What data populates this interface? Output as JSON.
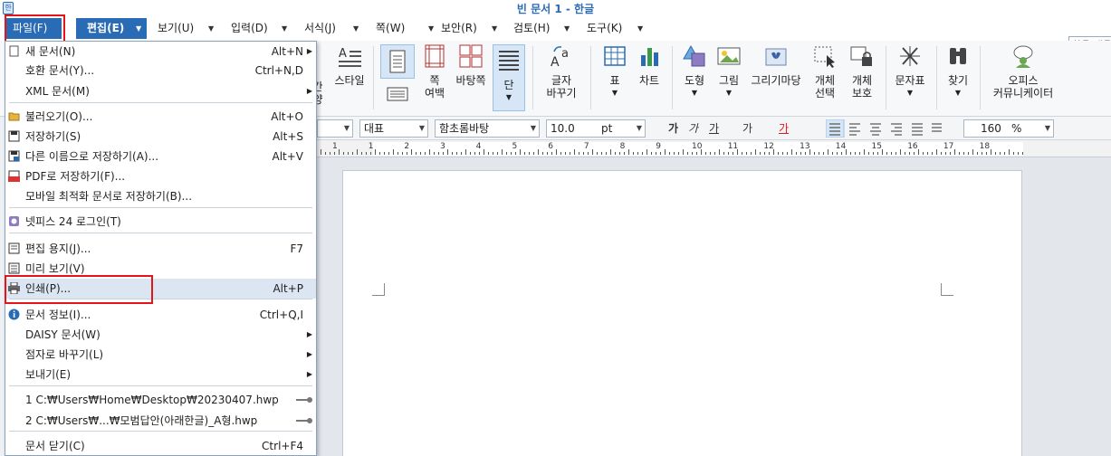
{
  "window": {
    "title": "빈 문서 1 - 한글",
    "app_icon": "hwp-app-icon"
  },
  "menubar": {
    "items": [
      {
        "label": "파일(F)"
      },
      {
        "label": "편집(E)"
      },
      {
        "label": "보기(U)"
      },
      {
        "label": "입력(D)"
      },
      {
        "label": "서식(J)"
      },
      {
        "label": "쪽(W)"
      },
      {
        "label": "보안(R)"
      },
      {
        "label": "검토(H)"
      },
      {
        "label": "도구(K)"
      }
    ],
    "search_placeholder": "찾을 내용"
  },
  "ribbon": {
    "partial_labels": [
      "간",
      "양",
      "스타일"
    ],
    "buttons": [
      {
        "label": "쪽\n여백",
        "icon": "page-margin-icon"
      },
      {
        "label": "바탕쪽",
        "icon": "master-page-icon"
      },
      {
        "label": "단",
        "icon": "columns-icon"
      },
      {
        "label": "글자\n바꾸기",
        "icon": "char-replace-icon"
      },
      {
        "label": "표",
        "icon": "table-icon"
      },
      {
        "label": "차트",
        "icon": "chart-icon"
      },
      {
        "label": "도형",
        "icon": "shape-icon"
      },
      {
        "label": "그림",
        "icon": "picture-icon"
      },
      {
        "label": "그리기마당",
        "icon": "clipart-icon"
      },
      {
        "label": "개체\n선택",
        "icon": "object-select-icon"
      },
      {
        "label": "개체\n보호",
        "icon": "object-protect-icon"
      },
      {
        "label": "문자표",
        "icon": "symbol-icon"
      },
      {
        "label": "찾기",
        "icon": "find-icon"
      },
      {
        "label": "오피스\n커뮤니케이터",
        "icon": "office-communicator-icon"
      }
    ]
  },
  "format_bar": {
    "style": "대표",
    "font": "함초롬바탕",
    "size": "10.0",
    "unit": "pt",
    "char_buttons": [
      "가",
      "가",
      "가",
      "가",
      "가"
    ],
    "line_spacing": "160",
    "line_spacing_unit": "%"
  },
  "ruler": {
    "numbers": [
      "1",
      "1",
      "2",
      "3",
      "4",
      "5",
      "6",
      "7",
      "8",
      "9",
      "10",
      "11",
      "12",
      "13",
      "14",
      "15",
      "16",
      "17",
      "18"
    ]
  },
  "file_menu": {
    "items": [
      {
        "label": "새 문서(N)",
        "shortcut": "Alt+N",
        "submenu": true,
        "icon": "new-doc-icon"
      },
      {
        "label": "호환 문서(Y)...",
        "shortcut": "Ctrl+N,D",
        "submenu": false,
        "icon": ""
      },
      {
        "label": "XML 문서(M)",
        "shortcut": "",
        "submenu": true,
        "icon": ""
      },
      {
        "label": "불러오기(O)...",
        "shortcut": "Alt+O",
        "submenu": false,
        "icon": "open-folder-icon"
      },
      {
        "label": "저장하기(S)",
        "shortcut": "Alt+S",
        "submenu": false,
        "icon": "save-icon"
      },
      {
        "label": "다른 이름으로 저장하기(A)...",
        "shortcut": "Alt+V",
        "submenu": false,
        "icon": "save-as-icon"
      },
      {
        "label": "PDF로 저장하기(F)...",
        "shortcut": "",
        "submenu": false,
        "icon": "pdf-icon"
      },
      {
        "label": "모바일 최적화 문서로 저장하기(B)...",
        "shortcut": "",
        "submenu": false,
        "icon": ""
      },
      {
        "label": "넷피스 24 로그인(T)",
        "shortcut": "",
        "submenu": false,
        "icon": "netffice-icon"
      },
      {
        "label": "편집 용지(J)...",
        "shortcut": "F7",
        "submenu": false,
        "icon": "page-setup-icon"
      },
      {
        "label": "미리 보기(V)",
        "shortcut": "",
        "submenu": false,
        "icon": "preview-icon"
      },
      {
        "label": "인쇄(P)...",
        "shortcut": "Alt+P",
        "submenu": false,
        "icon": "printer-icon"
      },
      {
        "label": "문서 정보(I)...",
        "shortcut": "Ctrl+Q,I",
        "submenu": false,
        "icon": "info-icon"
      },
      {
        "label": "DAISY 문서(W)",
        "shortcut": "",
        "submenu": true,
        "icon": ""
      },
      {
        "label": "점자로 바꾸기(L)",
        "shortcut": "",
        "submenu": true,
        "icon": ""
      },
      {
        "label": "보내기(E)",
        "shortcut": "",
        "submenu": true,
        "icon": ""
      },
      {
        "label": "1 C:₩Users₩Home₩Desktop₩20230407.hwp",
        "shortcut": "",
        "submenu": false,
        "icon": ""
      },
      {
        "label": "2 C:₩Users₩...₩모범답안(아래한글)_A형.hwp",
        "shortcut": "",
        "submenu": false,
        "icon": ""
      },
      {
        "label": "문서 닫기(C)",
        "shortcut": "Ctrl+F4",
        "submenu": false,
        "icon": ""
      }
    ]
  },
  "colors": {
    "accent": "#2a6bb5",
    "highlight": "#e5141b",
    "hover": "#dbe6f2"
  }
}
